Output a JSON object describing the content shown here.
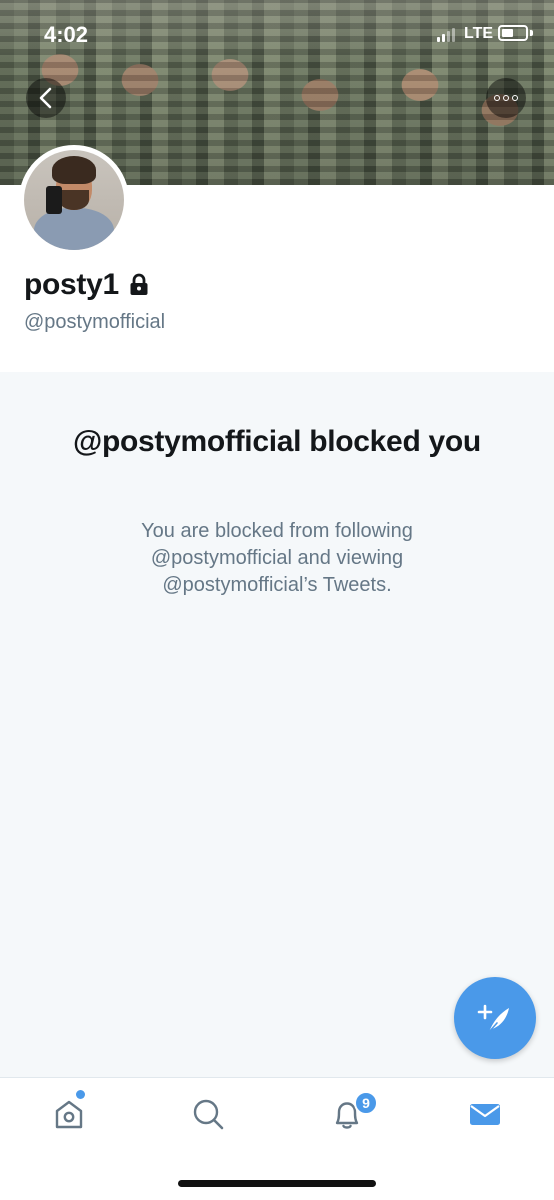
{
  "status_bar": {
    "time": "4:02",
    "network": "LTE",
    "battery_level": 0.5
  },
  "header": {
    "back_icon": "chevron-left-icon",
    "more_icon": "more-dots-icon"
  },
  "profile": {
    "display_name": "posty1",
    "protected_icon": "lock-icon",
    "handle": "@postymofficial"
  },
  "blocked": {
    "title": "@postymofficial blocked you",
    "description": "You are blocked from following @postymofficial and viewing @postymofficial’s Tweets."
  },
  "compose": {
    "icon": "compose-tweet-icon"
  },
  "tabbar": {
    "items": [
      {
        "name": "home",
        "icon": "home-icon",
        "has_new": true
      },
      {
        "name": "search",
        "icon": "search-icon"
      },
      {
        "name": "notifications",
        "icon": "bell-icon",
        "badge": "9"
      },
      {
        "name": "messages",
        "icon": "mail-icon",
        "active": true
      }
    ]
  },
  "colors": {
    "accent": "#4a99e9",
    "text_primary": "#14171a",
    "text_secondary": "#657786",
    "background": "#f5f8fa"
  }
}
